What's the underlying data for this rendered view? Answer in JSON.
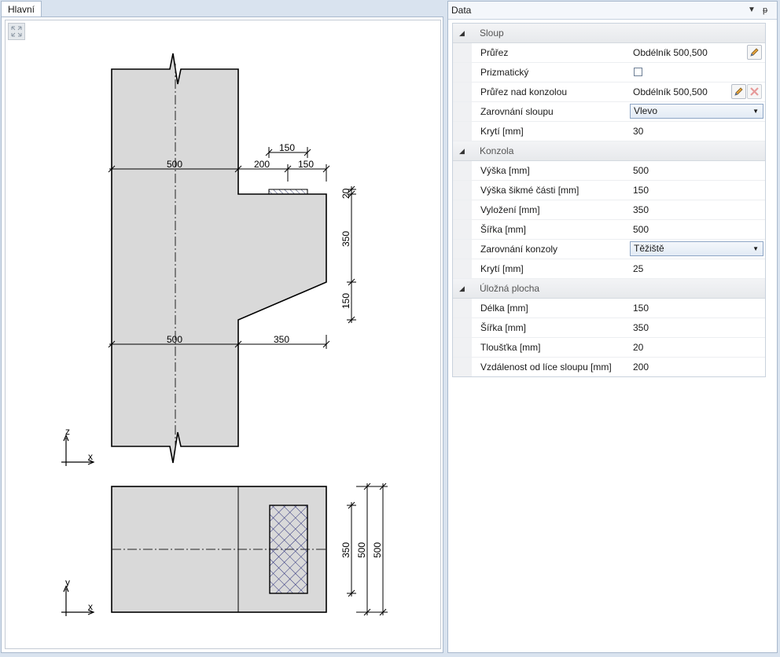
{
  "left_tab": {
    "label": "Hlavní"
  },
  "right_panel": {
    "title": "Data",
    "dropdown_glyph": "▼",
    "pin_glyph": "ᵽ",
    "sections": {
      "sloup": {
        "title": "Sloup",
        "rows": {
          "prurez": {
            "label": "Průřez",
            "value": "Obdélník 500,500"
          },
          "prizmaticky": {
            "label": "Prizmatický",
            "checked": false
          },
          "prurez_nad": {
            "label": "Průřez nad konzolou",
            "value": "Obdélník 500,500"
          },
          "zarovnani": {
            "label": "Zarovnání sloupu",
            "value": "Vlevo"
          },
          "kryti": {
            "label": "Krytí [mm]",
            "value": "30"
          }
        }
      },
      "konzola": {
        "title": "Konzola",
        "rows": {
          "vyska": {
            "label": "Výška [mm]",
            "value": "500"
          },
          "vyska_sikme": {
            "label": "Výška šikmé části [mm]",
            "value": "150"
          },
          "vylozeni": {
            "label": "Vyložení [mm]",
            "value": "350"
          },
          "sirka": {
            "label": "Šířka [mm]",
            "value": "500"
          },
          "zarovnani": {
            "label": "Zarovnání konzoly",
            "value": "Těžiště"
          },
          "kryti": {
            "label": "Krytí [mm]",
            "value": "25"
          }
        }
      },
      "ulozna": {
        "title": "Úložná plocha",
        "rows": {
          "delka": {
            "label": "Délka [mm]",
            "value": "150"
          },
          "sirka": {
            "label": "Šířka [mm]",
            "value": "350"
          },
          "tloustka": {
            "label": "Tloušťka [mm]",
            "value": "20"
          },
          "vzdalenost": {
            "label": "Vzdálenost od líce sloupu [mm]",
            "value": "200"
          }
        }
      }
    }
  },
  "drawing": {
    "dims": {
      "top_col": "500",
      "top_gap": "200",
      "top_pad": "150",
      "pad_len": "150",
      "v_thick": "20",
      "v_height": "350",
      "v_slope": "150",
      "mid_col": "500",
      "mid_cant": "350",
      "plan_pad": "350",
      "plan_w1": "500",
      "plan_w2": "500"
    },
    "axes": {
      "z": "z",
      "x1": "x",
      "y": "y",
      "x2": "x"
    }
  }
}
